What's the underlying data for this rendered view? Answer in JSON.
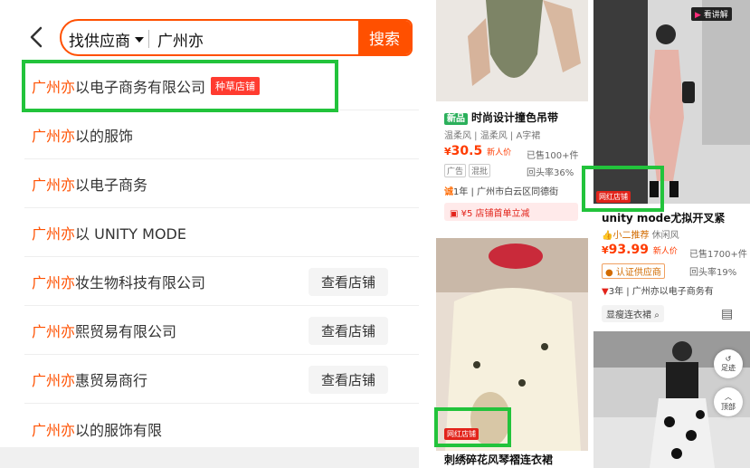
{
  "search": {
    "scope_label": "找供应商",
    "query": "广州亦",
    "button_label": "搜索"
  },
  "suggestions": [
    {
      "highlight": "广州亦",
      "rest": "以电子商务有限公司",
      "tag": "种草店铺",
      "shop_button": ""
    },
    {
      "highlight": "广州亦",
      "rest": "以的服饰",
      "tag": "",
      "shop_button": ""
    },
    {
      "highlight": "广州亦",
      "rest": "以电子商务",
      "tag": "",
      "shop_button": ""
    },
    {
      "highlight": "广州亦",
      "rest": "以 UNITY MODE",
      "tag": "",
      "shop_button": ""
    },
    {
      "highlight": "广州亦",
      "rest": "妆生物科技有限公司",
      "tag": "",
      "shop_button": "查看店铺"
    },
    {
      "highlight": "广州亦",
      "rest": "熙贸易有限公司",
      "tag": "",
      "shop_button": "查看店铺"
    },
    {
      "highlight": "广州亦",
      "rest": "惠贸易商行",
      "tag": "",
      "shop_button": "查看店铺"
    },
    {
      "highlight": "广州亦",
      "rest": "以的服饰有限",
      "tag": "",
      "shop_button": ""
    }
  ],
  "right": {
    "card1": {
      "new_badge": "新品",
      "title": "时尚设计撞色吊带",
      "tags_line": "温柔风 | 温柔风 | A字裙",
      "price_symbol": "¥",
      "price": "30.5",
      "price_note": "新人价",
      "sold": "已售100+件",
      "tag1": "广告",
      "tag2": "混批",
      "repurchase": "回头率36%",
      "years": "1年",
      "location": "广州市白云区同德街",
      "coupon": "¥5 店铺首单立减"
    },
    "card2": {
      "video_label": "看讲解",
      "wanghong": "网红店铺",
      "title": "unity mode尤拟开叉紧",
      "rec": "小二推荐",
      "rec_style": "休闲风",
      "price_symbol": "¥",
      "price": "93.99",
      "price_note": "新人价",
      "sold": "已售1700+件",
      "verified": "认证供应商",
      "repurchase": "回头率19%",
      "years": "3年",
      "supplier": "广州亦以电子商务有",
      "search_chip": "显瘦连衣裙"
    },
    "card3": {
      "wanghong": "网红店铺",
      "title": "刺绣碎花风琴褶连衣裙"
    },
    "float": {
      "back_label": "足迹",
      "top_label": "顶部"
    }
  },
  "colors": {
    "accent": "#ff5000",
    "highlight_box": "#22c33b",
    "tag_red": "#ff3b30"
  }
}
